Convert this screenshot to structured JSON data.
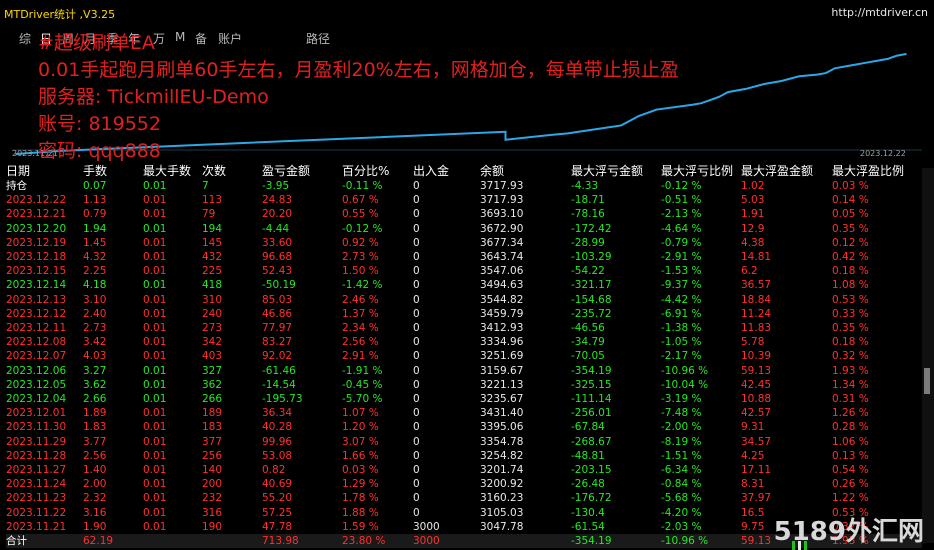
{
  "window": {
    "title": "MTDriver统计 ,V3.25",
    "url": "http://mtdriver.cn"
  },
  "tabs": [
    {
      "label": "综"
    },
    {
      "label": "日"
    },
    {
      "label": "周"
    },
    {
      "label": "月"
    },
    {
      "label": "季"
    },
    {
      "label": "年"
    },
    {
      "label": "万"
    },
    {
      "label": "M"
    },
    {
      "label": "备"
    },
    {
      "label": "账户"
    },
    {
      "label": "路径"
    }
  ],
  "overlay": {
    "line1": "#超级刷单EA",
    "line2": "0.01手起跑月刷单60手左右，月盈利20%左右，网格加仓，每单带止损止盈",
    "line3": "服务器: TickmillEU-Demo",
    "line4": "账号: 819552",
    "line5": "密码: qqq888"
  },
  "chart_data": {
    "type": "line",
    "x_start": "2023.11.21",
    "x_end": "2023.12.22",
    "line_color": "#2aa8e8",
    "values": [
      0.0,
      0.2,
      1.4,
      0.9,
      1.2,
      1.3,
      1.8,
      2.4,
      2.8,
      3.1,
      3.2,
      3.4,
      3.6,
      3.9,
      4.1,
      4.4,
      4.6,
      4.9,
      5.0,
      5.1,
      5.4,
      5.6,
      5.8,
      5.9,
      6.0,
      6.2,
      6.3
    ]
  },
  "table": {
    "headers": [
      "日期",
      "手数",
      "最大手数",
      "次数",
      "盈亏金额",
      "百分比%",
      "出入金",
      "余额",
      "最大浮亏金额",
      "最大浮亏比例",
      "最大浮盈金额",
      "最大浮盈比例"
    ],
    "holding": [
      "持仓",
      "0.07",
      "0.01",
      "7",
      "-3.95",
      "-0.11 %",
      "0",
      "3717.93",
      "-4.33",
      "-0.12 %",
      "1.02",
      "0.03 %"
    ],
    "rows": [
      {
        "cls": "pos",
        "v": [
          "2023.12.22",
          "1.13",
          "0.01",
          "113",
          "24.83",
          "0.67 %",
          "0",
          "3717.93",
          "-18.71",
          "-0.51 %",
          "5.03",
          "0.14 %"
        ]
      },
      {
        "cls": "pos",
        "v": [
          "2023.12.21",
          "0.79",
          "0.01",
          "79",
          "20.20",
          "0.55 %",
          "0",
          "3693.10",
          "-78.16",
          "-2.13 %",
          "1.91",
          "0.05 %"
        ]
      },
      {
        "cls": "neg",
        "v": [
          "2023.12.20",
          "1.94",
          "0.01",
          "194",
          "-4.44",
          "-0.12 %",
          "0",
          "3672.90",
          "-172.42",
          "-4.64 %",
          "12.9",
          "0.35 %"
        ]
      },
      {
        "cls": "pos",
        "v": [
          "2023.12.19",
          "1.45",
          "0.01",
          "145",
          "33.60",
          "0.92 %",
          "0",
          "3677.34",
          "-28.99",
          "-0.79 %",
          "4.38",
          "0.12 %"
        ]
      },
      {
        "cls": "pos",
        "v": [
          "2023.12.18",
          "4.32",
          "0.01",
          "432",
          "96.68",
          "2.73 %",
          "0",
          "3643.74",
          "-103.29",
          "-2.91 %",
          "14.81",
          "0.42 %"
        ]
      },
      {
        "cls": "pos",
        "v": [
          "2023.12.15",
          "2.25",
          "0.01",
          "225",
          "52.43",
          "1.50 %",
          "0",
          "3547.06",
          "-54.22",
          "-1.53 %",
          "6.2",
          "0.18 %"
        ]
      },
      {
        "cls": "neg",
        "v": [
          "2023.12.14",
          "4.18",
          "0.01",
          "418",
          "-50.19",
          "-1.42 %",
          "0",
          "3494.63",
          "-321.17",
          "-9.37 %",
          "36.57",
          "1.08 %"
        ]
      },
      {
        "cls": "pos",
        "v": [
          "2023.12.13",
          "3.10",
          "0.01",
          "310",
          "85.03",
          "2.46 %",
          "0",
          "3544.82",
          "-154.68",
          "-4.42 %",
          "18.84",
          "0.53 %"
        ]
      },
      {
        "cls": "pos",
        "v": [
          "2023.12.12",
          "2.40",
          "0.01",
          "240",
          "46.86",
          "1.37 %",
          "0",
          "3459.79",
          "-235.72",
          "-6.91 %",
          "11.24",
          "0.33 %"
        ]
      },
      {
        "cls": "pos",
        "v": [
          "2023.12.11",
          "2.73",
          "0.01",
          "273",
          "77.97",
          "2.34 %",
          "0",
          "3412.93",
          "-46.56",
          "-1.38 %",
          "11.83",
          "0.35 %"
        ]
      },
      {
        "cls": "pos",
        "v": [
          "2023.12.08",
          "3.42",
          "0.01",
          "342",
          "83.27",
          "2.56 %",
          "0",
          "3334.96",
          "-34.79",
          "-1.05 %",
          "5.78",
          "0.18 %"
        ]
      },
      {
        "cls": "pos",
        "v": [
          "2023.12.07",
          "4.03",
          "0.01",
          "403",
          "92.02",
          "2.91 %",
          "0",
          "3251.69",
          "-70.05",
          "-2.17 %",
          "10.39",
          "0.32 %"
        ]
      },
      {
        "cls": "neg",
        "v": [
          "2023.12.06",
          "3.27",
          "0.01",
          "327",
          "-61.46",
          "-1.91 %",
          "0",
          "3159.67",
          "-354.19",
          "-10.96 %",
          "59.13",
          "1.93 %"
        ]
      },
      {
        "cls": "neg",
        "v": [
          "2023.12.05",
          "3.62",
          "0.01",
          "362",
          "-14.54",
          "-0.45 %",
          "0",
          "3221.13",
          "-325.15",
          "-10.04 %",
          "42.45",
          "1.34 %"
        ]
      },
      {
        "cls": "neg",
        "v": [
          "2023.12.04",
          "2.66",
          "0.01",
          "266",
          "-195.73",
          "-5.70 %",
          "0",
          "3235.67",
          "-111.14",
          "-3.19 %",
          "10.88",
          "0.31 %"
        ]
      },
      {
        "cls": "pos",
        "v": [
          "2023.12.01",
          "1.89",
          "0.01",
          "189",
          "36.34",
          "1.07 %",
          "0",
          "3431.40",
          "-256.01",
          "-7.48 %",
          "42.57",
          "1.26 %"
        ]
      },
      {
        "cls": "pos",
        "v": [
          "2023.11.30",
          "1.83",
          "0.01",
          "183",
          "40.28",
          "1.20 %",
          "0",
          "3395.06",
          "-67.84",
          "-2.00 %",
          "9.31",
          "0.28 %"
        ]
      },
      {
        "cls": "pos",
        "v": [
          "2023.11.29",
          "3.77",
          "0.01",
          "377",
          "99.96",
          "3.07 %",
          "0",
          "3354.78",
          "-268.67",
          "-8.19 %",
          "34.57",
          "1.06 %"
        ]
      },
      {
        "cls": "pos",
        "v": [
          "2023.11.28",
          "2.56",
          "0.01",
          "256",
          "53.08",
          "1.66 %",
          "0",
          "3254.82",
          "-48.81",
          "-1.51 %",
          "4.25",
          "0.13 %"
        ]
      },
      {
        "cls": "pos",
        "v": [
          "2023.11.27",
          "1.40",
          "0.01",
          "140",
          "0.82",
          "0.03 %",
          "0",
          "3201.74",
          "-203.15",
          "-6.34 %",
          "17.11",
          "0.54 %"
        ]
      },
      {
        "cls": "pos",
        "v": [
          "2023.11.24",
          "2.00",
          "0.01",
          "200",
          "40.69",
          "1.29 %",
          "0",
          "3200.92",
          "-26.48",
          "-0.84 %",
          "8.31",
          "0.26 %"
        ]
      },
      {
        "cls": "pos",
        "v": [
          "2023.11.23",
          "2.32",
          "0.01",
          "232",
          "55.20",
          "1.78 %",
          "0",
          "3160.23",
          "-176.72",
          "-5.68 %",
          "37.97",
          "1.22 %"
        ]
      },
      {
        "cls": "pos",
        "v": [
          "2023.11.22",
          "3.16",
          "0.01",
          "316",
          "57.25",
          "1.88 %",
          "0",
          "3105.03",
          "-130.4",
          "-4.20 %",
          "16.5",
          "0.53 %"
        ]
      },
      {
        "cls": "pos",
        "v": [
          "2023.11.21",
          "1.90",
          "0.01",
          "190",
          "47.78",
          "1.59 %",
          "3000",
          "3047.78",
          "-61.54",
          "-2.03 %",
          "9.75",
          "0.32 %"
        ]
      }
    ],
    "total": [
      "合计",
      "62.19",
      "",
      "",
      "713.98",
      "23.80 %",
      "3000",
      "",
      "-354.19",
      "-10.96 %",
      "59.13",
      "1.93 %"
    ]
  },
  "watermark": "5189外汇网"
}
